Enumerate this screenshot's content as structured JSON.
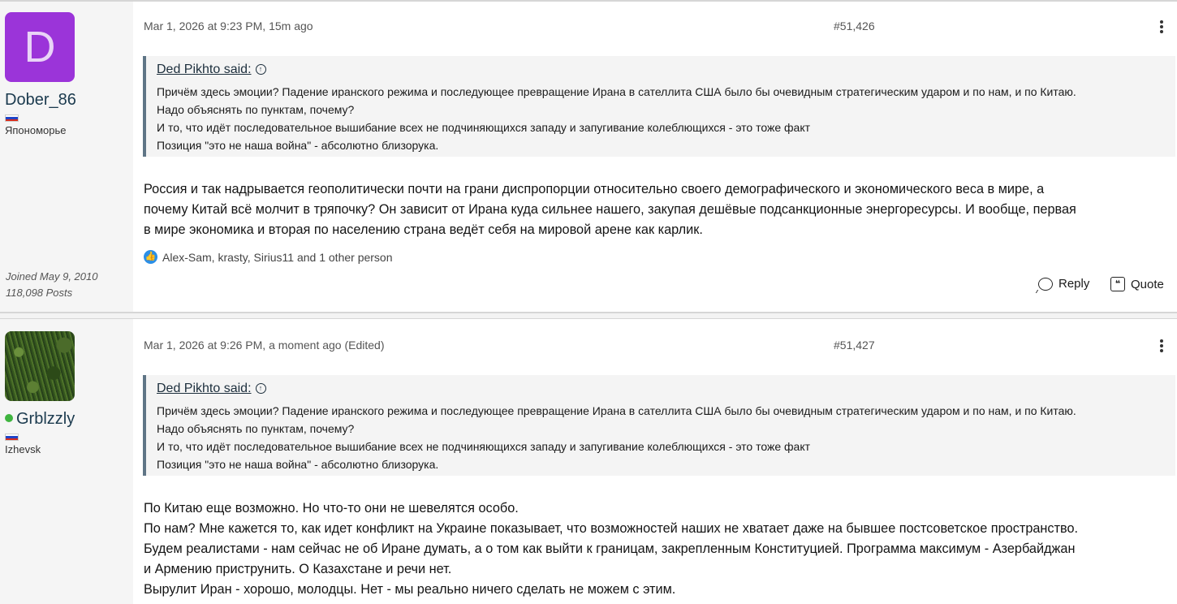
{
  "posts": [
    {
      "author": {
        "avatar_letter": "D",
        "avatar_color": "#9b34d9",
        "name": "Dober_86",
        "location": "Япономорье",
        "joined": "Joined May 9, 2010",
        "posts_count": "118,098 Posts",
        "flag": "russia-flag-icon"
      },
      "date": "Mar 1, 2026 at 9:23 PM, 15m ago",
      "number": "#51,426",
      "quote": {
        "author": "Ded Pikhto said:",
        "lines": [
          "Причём здесь эмоции? Падение иранского режима и последующее превращение Ирана в сателлита США было бы очевидным стратегическим ударом и по нам, и по Китаю.",
          "Надо объяснять по пунктам, почему?",
          "И то, что идёт последовательное вышибание всех не подчиняющихся западу и запугивание колеблющихся - это тоже факт",
          "Позиция \"это не наша война\" - абсолютно близорука."
        ]
      },
      "body": [
        "Россия и так надрывается геополитически почти на грани диспропорции относительно своего демографического и экономического веса в мире, а",
        "почему Китай всё молчит в тряпочку? Он зависит от Ирана куда сильнее нашего, закупая дешёвые подсанкционные энергоресурсы. И вообще, первая",
        "в мире экономика и вторая по населению страна ведёт себя на мировой арене как карлик."
      ],
      "reactions": "Alex-Sam, krasty, Sirius11 and 1 other person",
      "actions": {
        "reply": "Reply",
        "quote": "Quote"
      }
    },
    {
      "author": {
        "name": "Grblzzly",
        "online": true,
        "location": "Izhevsk",
        "flag": "russia-flag-icon"
      },
      "date": "Mar 1, 2026 at 9:26 PM, a moment ago (Edited)",
      "number": "#51,427",
      "quote": {
        "author": "Ded Pikhto said:",
        "lines": [
          "Причём здесь эмоции? Падение иранского режима и последующее превращение Ирана в сателлита США было бы очевидным стратегическим ударом и по нам, и по Китаю.",
          "Надо объяснять по пунктам, почему?",
          "И то, что идёт последовательное вышибание всех не подчиняющихся западу и запугивание колеблющихся - это тоже факт",
          "Позиция \"это не наша война\" - абсолютно близорука."
        ]
      },
      "body": [
        "По Китаю еще возможно. Но что-то они не шевелятся особо.",
        "По нам? Мне кажется то, как идет конфликт на Украине показывает, что возможностей наших не хватает даже на бывшее постсоветское пространство.",
        "Будем реалистами - нам сейчас не об Иране думать, а о том как выйти к границам, закрепленным Конституцией. Программа максимум - Азербайджан",
        "и Армению приструнить. О Казахстане и речи нет.",
        "Вырулит Иран - хорошо, молодцы. Нет - мы реально ничего сделать не можем с этим."
      ]
    }
  ]
}
